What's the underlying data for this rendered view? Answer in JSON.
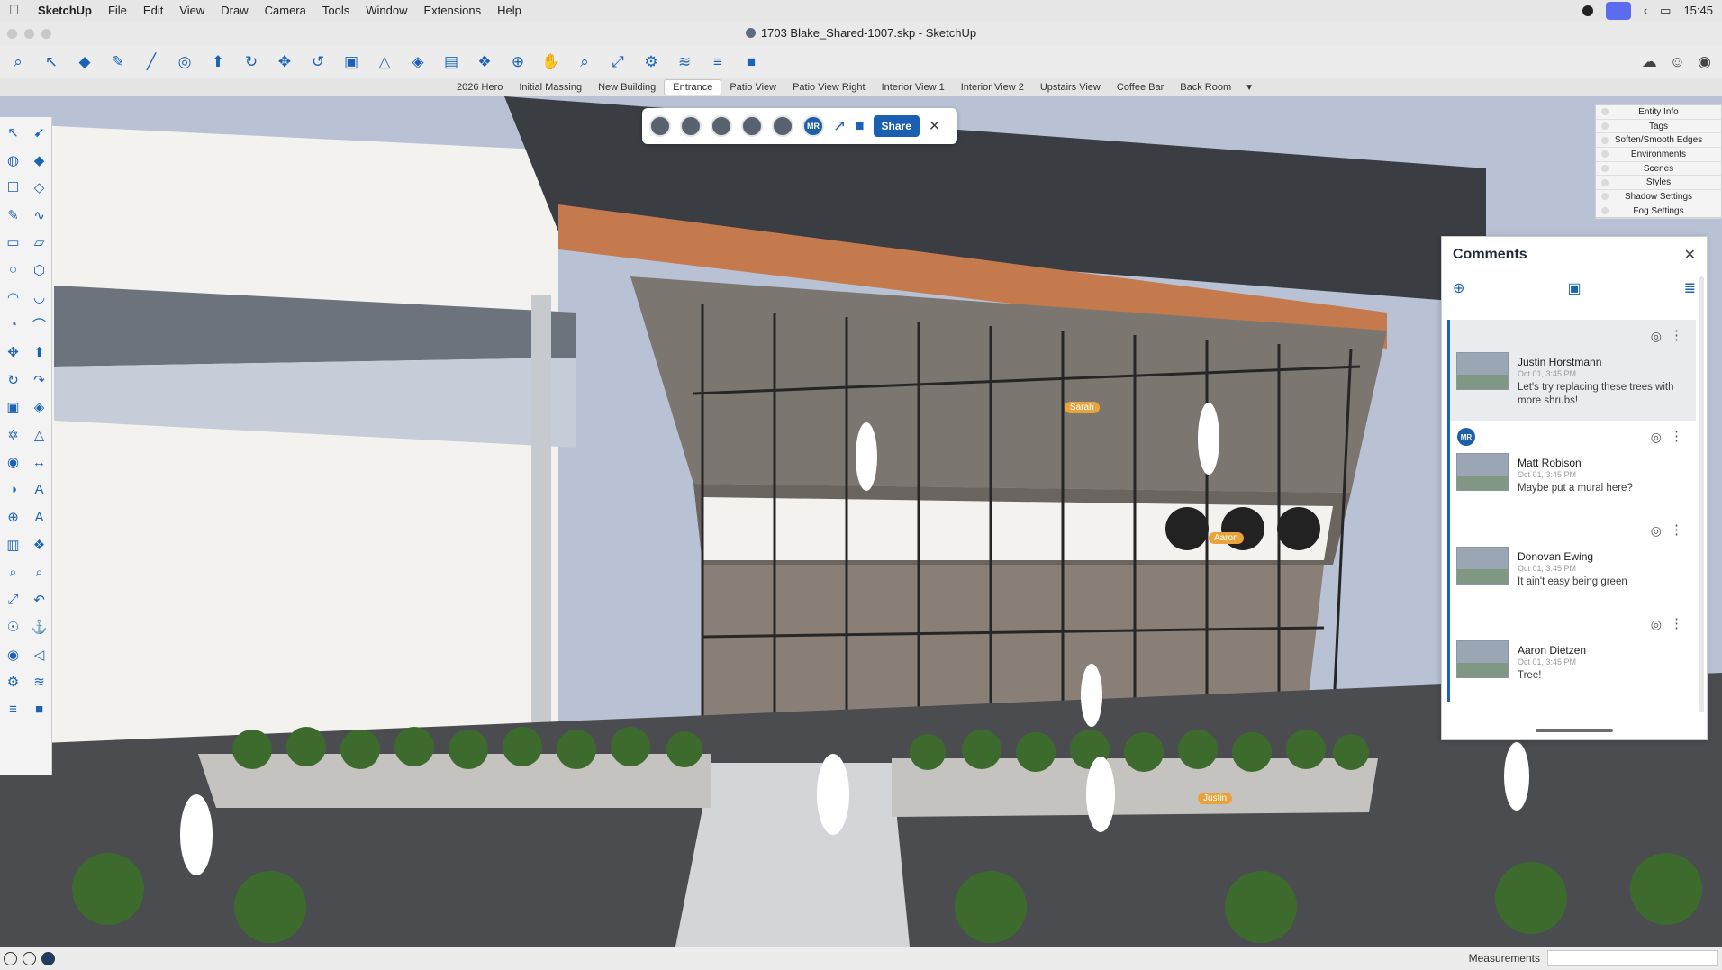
{
  "menubar": {
    "app_name": "SketchUp",
    "menus": [
      "File",
      "Edit",
      "View",
      "Draw",
      "Camera",
      "Tools",
      "Window",
      "Extensions",
      "Help"
    ],
    "clock": "15:45"
  },
  "window": {
    "title": "1703 Blake_Shared-1007.skp - SketchUp"
  },
  "scenes": {
    "tabs": [
      "2026 Hero",
      "Initial Massing",
      "New Building",
      "Entrance",
      "Patio View",
      "Patio View Right",
      "Interior View 1",
      "Interior View 2",
      "Upstairs View",
      "Coffee Bar",
      "Back Room"
    ],
    "active": "Entrance",
    "more_icon": "▼"
  },
  "tray": {
    "items": [
      "Entity Info",
      "Tags",
      "Soften/Smooth Edges",
      "Environments",
      "Scenes",
      "Styles",
      "Shadow Settings",
      "Fog Settings"
    ]
  },
  "collab_bar": {
    "mr_initials": "MR",
    "share_label": "Share"
  },
  "comments": {
    "title": "Comments",
    "items": [
      {
        "name": "Justin Horstmann",
        "date": "Oct 01, 3:45 PM",
        "text": "Let's try replacing these trees with more shrubs!",
        "initials": ""
      },
      {
        "name": "Matt Robison",
        "date": "Oct 01, 3:45 PM",
        "text": "Maybe put a mural here?",
        "initials": "MR"
      },
      {
        "name": "Donovan Ewing",
        "date": "Oct 01, 3:45 PM",
        "text": "It ain't easy being green",
        "initials": ""
      },
      {
        "name": "Aaron Dietzen",
        "date": "Oct 01, 3:45 PM",
        "text": "Tree!",
        "initials": ""
      }
    ]
  },
  "viewport": {
    "user_tags": [
      "Sarah",
      "Aaron",
      "Justin"
    ]
  },
  "statusbar": {
    "measurements_label": "Measurements"
  }
}
